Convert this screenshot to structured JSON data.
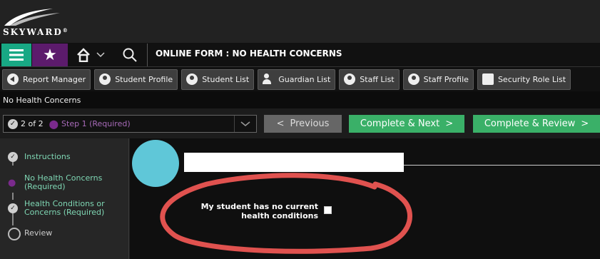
{
  "app": {
    "logo_text": "SKYWARD",
    "logo_tm": "®"
  },
  "nav": {
    "title": "ONLINE FORM : NO HEALTH CONCERNS"
  },
  "toolbar": {
    "items": [
      {
        "label": "Report Manager",
        "icon": "report-icon"
      },
      {
        "label": "Student Profile",
        "icon": "student-profile-icon"
      },
      {
        "label": "Student List",
        "icon": "student-list-icon"
      },
      {
        "label": "Guardian List",
        "icon": "guardian-icon"
      },
      {
        "label": "Staff List",
        "icon": "staff-list-icon"
      },
      {
        "label": "Staff Profile",
        "icon": "staff-profile-icon"
      },
      {
        "label": "Security Role List",
        "icon": "security-role-icon"
      }
    ]
  },
  "breadcrumb": "No Health Concerns",
  "step": {
    "count": "2 of 2",
    "selected": "Step 1 (Required)",
    "prev": "Previous",
    "next": "Complete & Next",
    "review": "Complete & Review"
  },
  "sidebar": {
    "items": [
      {
        "label": "Instructions",
        "status": "done"
      },
      {
        "label": "No Health Concerns (Required)",
        "status": "current"
      },
      {
        "label": "Health Conditions or Concerns (Required)",
        "status": "done"
      },
      {
        "label": "Review",
        "status": "pending"
      }
    ]
  },
  "form": {
    "question": "My student has no current health conditions",
    "checked": false
  },
  "colors": {
    "accent_green": "#3ab068",
    "menu_teal": "#18a884",
    "star_purple": "#5c1b6c",
    "annotation_red": "#e0524f",
    "avatar_blue": "#5fc7d8"
  }
}
